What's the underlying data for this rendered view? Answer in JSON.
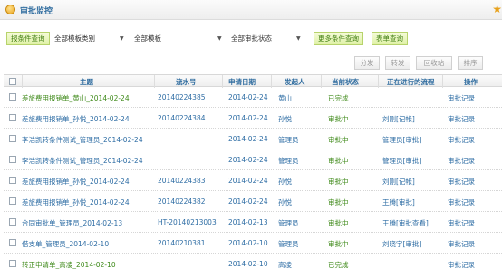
{
  "header": {
    "title": "审批监控"
  },
  "filters": {
    "condition_query": "报条件查询",
    "template_category": "全部模板类别",
    "template": "全部模板",
    "status": "全部审批状态",
    "more_query": "更多条件查询",
    "form_query": "表单查询"
  },
  "actions": {
    "distribute": "分发",
    "forward": "转发",
    "recycle": "回收站",
    "sort": "排序"
  },
  "columns": [
    "主题",
    "流水号",
    "申请日期",
    "发起人",
    "当前状态",
    "正在进行的流程",
    "操作"
  ],
  "rows": [
    {
      "subject": "差旅费用报销单_黄山_2014-02-24",
      "serial": "20140224385",
      "date": "2014-02-24",
      "initiator": "黄山",
      "status": "已完成",
      "process": "",
      "op": "审批记录",
      "subject_green": true
    },
    {
      "subject": "差旅费用报销单_孙悦_2014-02-24",
      "serial": "20140224384",
      "date": "2014-02-24",
      "initiator": "孙悦",
      "status": "审批中",
      "process": "刘刚[记帐]",
      "op": "审批记录",
      "subject_green": false
    },
    {
      "subject": "李浩凯转条件测试_管理员_2014-02-24",
      "serial": "",
      "date": "2014-02-24",
      "initiator": "管理员",
      "status": "审批中",
      "process": "管理员[审批]",
      "op": "审批记录",
      "subject_green": false
    },
    {
      "subject": "李浩凯转条件测试_管理员_2014-02-24",
      "serial": "",
      "date": "2014-02-24",
      "initiator": "管理员",
      "status": "审批中",
      "process": "管理员[审批]",
      "op": "审批记录",
      "subject_green": false
    },
    {
      "subject": "差旅费用报销单_孙悦_2014-02-24",
      "serial": "20140224383",
      "date": "2014-02-24",
      "initiator": "孙悦",
      "status": "审批中",
      "process": "刘刚[记帐]",
      "op": "审批记录",
      "subject_green": false
    },
    {
      "subject": "差旅费用报销单_孙悦_2014-02-24",
      "serial": "20140224382",
      "date": "2014-02-24",
      "initiator": "孙悦",
      "status": "审批中",
      "process": "王腾[审批]",
      "op": "审批记录",
      "subject_green": false
    },
    {
      "subject": "合同审批单_管理员_2014-02-13",
      "serial": "HT-20140213003",
      "date": "2014-02-13",
      "initiator": "管理员",
      "status": "审批中",
      "process": "王腾[审批查看]",
      "op": "审批记录",
      "subject_green": false
    },
    {
      "subject": "借支单_管理员_2014-02-10",
      "serial": "20140210381",
      "date": "2014-02-10",
      "initiator": "管理员",
      "status": "审批中",
      "process": "刘晓宇[审批]",
      "op": "审批记录",
      "subject_green": false
    },
    {
      "subject": "转正申请单_高凌_2014-02-10",
      "serial": "",
      "date": "2014-02-10",
      "initiator": "高凌",
      "status": "已完成",
      "process": "",
      "op": "审批记录",
      "subject_green": true
    }
  ]
}
